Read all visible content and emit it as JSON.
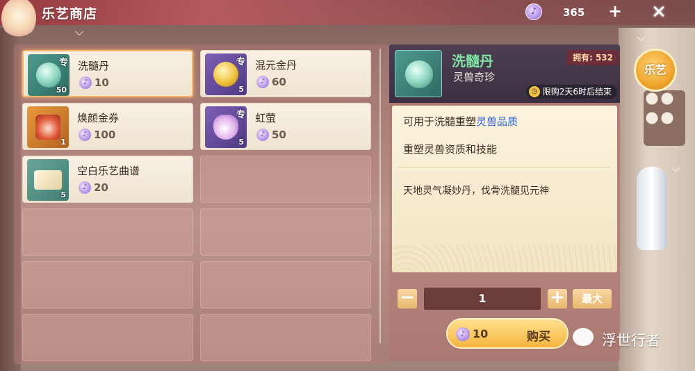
{
  "header": {
    "title": "乐艺商店",
    "currency_amount": "365",
    "plus_glyph": "+",
    "close_glyph": "✕"
  },
  "items": [
    {
      "name": "洗髓丹",
      "price": "10",
      "count": "50",
      "tag": "专",
      "thumb_color": "#4f9a8c",
      "selected": true
    },
    {
      "name": "混元金丹",
      "price": "60",
      "count": "5",
      "tag": "专",
      "thumb_color": "#7e5fb5",
      "selected": false
    },
    {
      "name": "焕颜金券",
      "price": "100",
      "count": "1",
      "tag": "",
      "thumb_color": "#e99a3b",
      "selected": false
    },
    {
      "name": "虹萤",
      "price": "50",
      "count": "5",
      "tag": "专",
      "thumb_color": "#7e5fb5",
      "selected": false
    },
    {
      "name": "空白乐艺曲谱",
      "price": "20",
      "count": "5",
      "tag": "",
      "thumb_color": "#6aa59a",
      "selected": false
    }
  ],
  "detail": {
    "name": "洗髓丹",
    "category": "灵兽奇珍",
    "owned_label": "拥有:",
    "owned_value": "532",
    "limit_text": "限购2天6时后结束",
    "desc_line1_prefix": "可用于洗髓重塑",
    "desc_line1_highlight": "灵兽品质",
    "desc_line2": "重塑灵兽资质和技能",
    "flavor": "天地灵气凝妙丹，伐骨洗髓见元神",
    "quantity": "1",
    "minus_glyph": "−",
    "plus_glyph": "+",
    "max_label": "最大",
    "buy_price": "10",
    "buy_label": "购买"
  },
  "side_badge": "乐艺",
  "watermark": "浮世行者",
  "colors": {
    "accent_gold": "#f5b53f",
    "name_green": "#7ee3a4",
    "highlight_blue": "#2f63d8",
    "topbar_red": "#963740"
  }
}
